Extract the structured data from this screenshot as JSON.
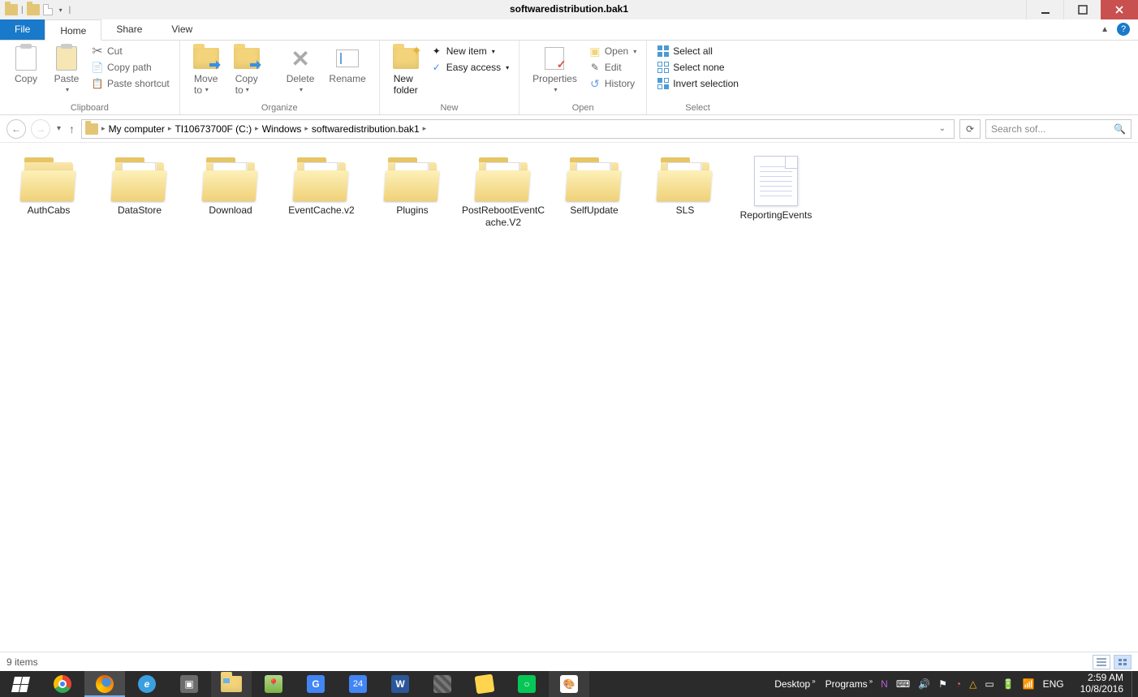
{
  "window": {
    "title": "softwaredistribution.bak1"
  },
  "tabs": {
    "file": "File",
    "home": "Home",
    "share": "Share",
    "view": "View"
  },
  "ribbon": {
    "clipboard": {
      "label": "Clipboard",
      "copy": "Copy",
      "paste": "Paste",
      "cut": "Cut",
      "copypath": "Copy path",
      "pasteshortcut": "Paste shortcut"
    },
    "organize": {
      "label": "Organize",
      "moveto": "Move\nto",
      "copyto": "Copy\nto",
      "delete": "Delete",
      "rename": "Rename"
    },
    "new": {
      "label": "New",
      "newfolder": "New\nfolder",
      "newitem": "New item",
      "easyaccess": "Easy access"
    },
    "open": {
      "label": "Open",
      "properties": "Properties",
      "open": "Open",
      "edit": "Edit",
      "history": "History"
    },
    "select": {
      "label": "Select",
      "selectall": "Select all",
      "selectnone": "Select none",
      "invert": "Invert selection"
    }
  },
  "breadcrumb": [
    "My computer",
    "TI10673700F (C:)",
    "Windows",
    "softwaredistribution.bak1"
  ],
  "search": {
    "placeholder": "Search sof..."
  },
  "items": [
    {
      "name": "AuthCabs",
      "type": "folder-empty"
    },
    {
      "name": "DataStore",
      "type": "folder"
    },
    {
      "name": "Download",
      "type": "folder"
    },
    {
      "name": "EventCache.v2",
      "type": "folder"
    },
    {
      "name": "Plugins",
      "type": "folder"
    },
    {
      "name": "PostRebootEventCache.V2",
      "type": "folder"
    },
    {
      "name": "SelfUpdate",
      "type": "folder"
    },
    {
      "name": "SLS",
      "type": "folder"
    },
    {
      "name": "ReportingEvents",
      "type": "file"
    }
  ],
  "status": {
    "count": "9 items"
  },
  "taskbar": {
    "desktop": "Desktop",
    "programs": "Programs",
    "lang": "ENG",
    "time": "2:59 AM",
    "date": "10/8/2016"
  }
}
